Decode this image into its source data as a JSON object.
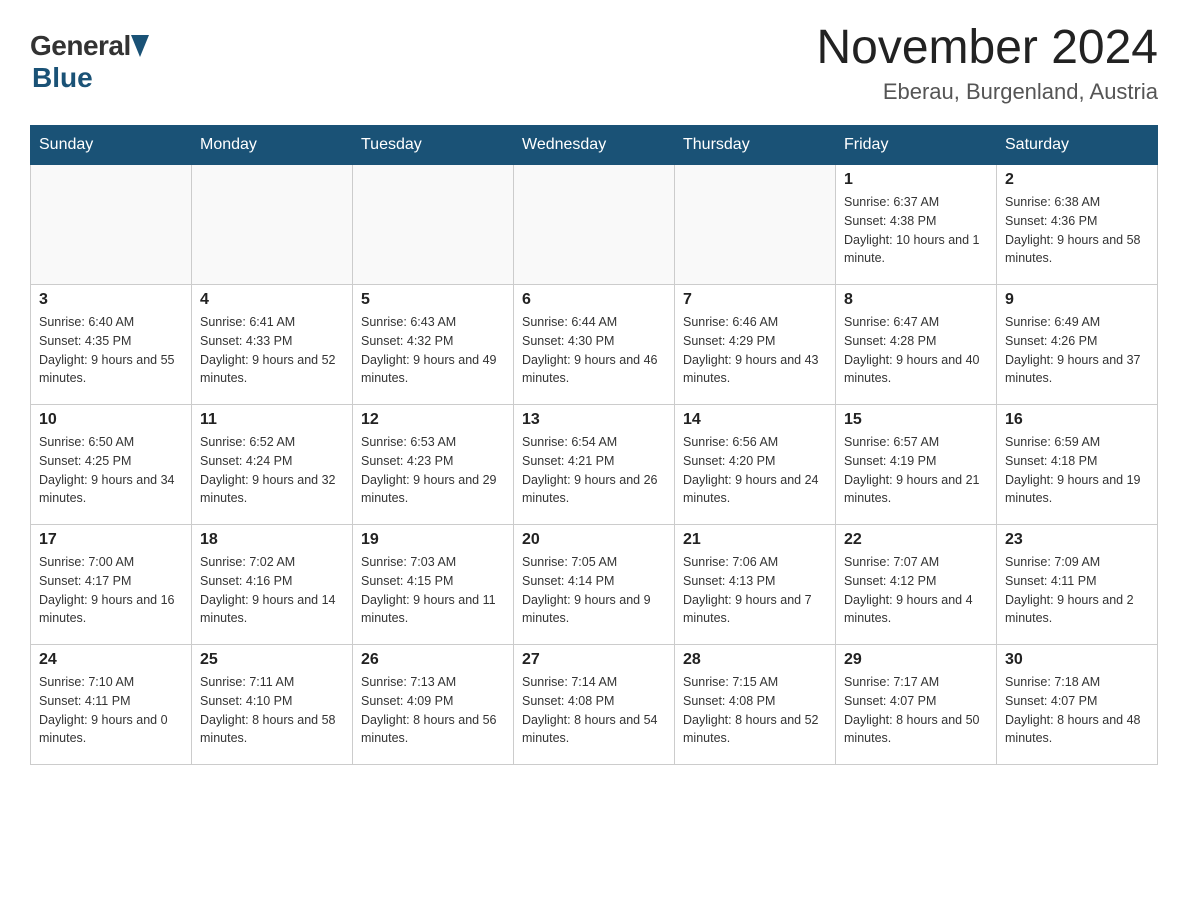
{
  "header": {
    "logo": {
      "general": "General",
      "blue": "Blue"
    },
    "title": "November 2024",
    "subtitle": "Eberau, Burgenland, Austria"
  },
  "calendar": {
    "days": [
      "Sunday",
      "Monday",
      "Tuesday",
      "Wednesday",
      "Thursday",
      "Friday",
      "Saturday"
    ],
    "weeks": [
      [
        {
          "day": "",
          "info": ""
        },
        {
          "day": "",
          "info": ""
        },
        {
          "day": "",
          "info": ""
        },
        {
          "day": "",
          "info": ""
        },
        {
          "day": "",
          "info": ""
        },
        {
          "day": "1",
          "info": "Sunrise: 6:37 AM\nSunset: 4:38 PM\nDaylight: 10 hours and 1 minute."
        },
        {
          "day": "2",
          "info": "Sunrise: 6:38 AM\nSunset: 4:36 PM\nDaylight: 9 hours and 58 minutes."
        }
      ],
      [
        {
          "day": "3",
          "info": "Sunrise: 6:40 AM\nSunset: 4:35 PM\nDaylight: 9 hours and 55 minutes."
        },
        {
          "day": "4",
          "info": "Sunrise: 6:41 AM\nSunset: 4:33 PM\nDaylight: 9 hours and 52 minutes."
        },
        {
          "day": "5",
          "info": "Sunrise: 6:43 AM\nSunset: 4:32 PM\nDaylight: 9 hours and 49 minutes."
        },
        {
          "day": "6",
          "info": "Sunrise: 6:44 AM\nSunset: 4:30 PM\nDaylight: 9 hours and 46 minutes."
        },
        {
          "day": "7",
          "info": "Sunrise: 6:46 AM\nSunset: 4:29 PM\nDaylight: 9 hours and 43 minutes."
        },
        {
          "day": "8",
          "info": "Sunrise: 6:47 AM\nSunset: 4:28 PM\nDaylight: 9 hours and 40 minutes."
        },
        {
          "day": "9",
          "info": "Sunrise: 6:49 AM\nSunset: 4:26 PM\nDaylight: 9 hours and 37 minutes."
        }
      ],
      [
        {
          "day": "10",
          "info": "Sunrise: 6:50 AM\nSunset: 4:25 PM\nDaylight: 9 hours and 34 minutes."
        },
        {
          "day": "11",
          "info": "Sunrise: 6:52 AM\nSunset: 4:24 PM\nDaylight: 9 hours and 32 minutes."
        },
        {
          "day": "12",
          "info": "Sunrise: 6:53 AM\nSunset: 4:23 PM\nDaylight: 9 hours and 29 minutes."
        },
        {
          "day": "13",
          "info": "Sunrise: 6:54 AM\nSunset: 4:21 PM\nDaylight: 9 hours and 26 minutes."
        },
        {
          "day": "14",
          "info": "Sunrise: 6:56 AM\nSunset: 4:20 PM\nDaylight: 9 hours and 24 minutes."
        },
        {
          "day": "15",
          "info": "Sunrise: 6:57 AM\nSunset: 4:19 PM\nDaylight: 9 hours and 21 minutes."
        },
        {
          "day": "16",
          "info": "Sunrise: 6:59 AM\nSunset: 4:18 PM\nDaylight: 9 hours and 19 minutes."
        }
      ],
      [
        {
          "day": "17",
          "info": "Sunrise: 7:00 AM\nSunset: 4:17 PM\nDaylight: 9 hours and 16 minutes."
        },
        {
          "day": "18",
          "info": "Sunrise: 7:02 AM\nSunset: 4:16 PM\nDaylight: 9 hours and 14 minutes."
        },
        {
          "day": "19",
          "info": "Sunrise: 7:03 AM\nSunset: 4:15 PM\nDaylight: 9 hours and 11 minutes."
        },
        {
          "day": "20",
          "info": "Sunrise: 7:05 AM\nSunset: 4:14 PM\nDaylight: 9 hours and 9 minutes."
        },
        {
          "day": "21",
          "info": "Sunrise: 7:06 AM\nSunset: 4:13 PM\nDaylight: 9 hours and 7 minutes."
        },
        {
          "day": "22",
          "info": "Sunrise: 7:07 AM\nSunset: 4:12 PM\nDaylight: 9 hours and 4 minutes."
        },
        {
          "day": "23",
          "info": "Sunrise: 7:09 AM\nSunset: 4:11 PM\nDaylight: 9 hours and 2 minutes."
        }
      ],
      [
        {
          "day": "24",
          "info": "Sunrise: 7:10 AM\nSunset: 4:11 PM\nDaylight: 9 hours and 0 minutes."
        },
        {
          "day": "25",
          "info": "Sunrise: 7:11 AM\nSunset: 4:10 PM\nDaylight: 8 hours and 58 minutes."
        },
        {
          "day": "26",
          "info": "Sunrise: 7:13 AM\nSunset: 4:09 PM\nDaylight: 8 hours and 56 minutes."
        },
        {
          "day": "27",
          "info": "Sunrise: 7:14 AM\nSunset: 4:08 PM\nDaylight: 8 hours and 54 minutes."
        },
        {
          "day": "28",
          "info": "Sunrise: 7:15 AM\nSunset: 4:08 PM\nDaylight: 8 hours and 52 minutes."
        },
        {
          "day": "29",
          "info": "Sunrise: 7:17 AM\nSunset: 4:07 PM\nDaylight: 8 hours and 50 minutes."
        },
        {
          "day": "30",
          "info": "Sunrise: 7:18 AM\nSunset: 4:07 PM\nDaylight: 8 hours and 48 minutes."
        }
      ]
    ]
  }
}
